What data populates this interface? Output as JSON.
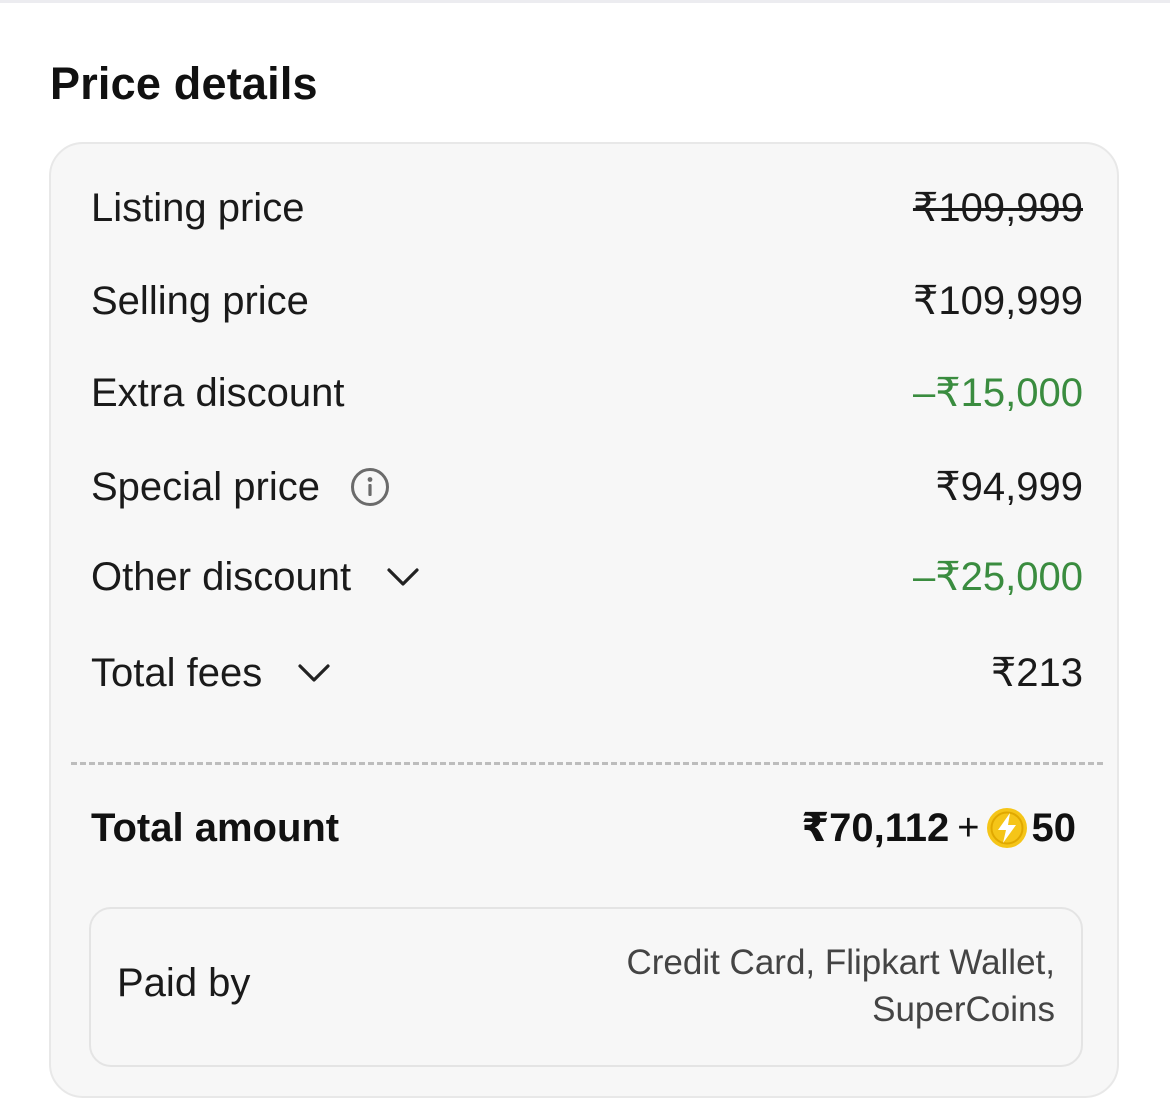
{
  "section": {
    "title": "Price details"
  },
  "rows": [
    {
      "label": "Listing price",
      "value": "₹109,999"
    },
    {
      "label": "Selling price",
      "value": "₹109,999"
    },
    {
      "label": "Extra discount",
      "value": "–₹15,000"
    },
    {
      "label": "Special price",
      "value": "₹94,999"
    },
    {
      "label": "Other discount",
      "value": "–₹25,000"
    },
    {
      "label": "Total fees",
      "value": "₹213"
    }
  ],
  "total": {
    "label": "Total amount",
    "amount": "₹70,112",
    "plus": "+",
    "coins": "50"
  },
  "paid_by": {
    "label": "Paid by",
    "line1": "Credit Card, Flipkart Wallet,",
    "line2": "SuperCoins"
  },
  "colors": {
    "discount_green": "#3a8c3f",
    "card_background": "#f7f7f7",
    "coin_yellow": "#f5c518"
  },
  "icons": {
    "info": "info-circle-icon",
    "chevron": "chevron-down-icon",
    "coin": "supercoin-icon"
  }
}
